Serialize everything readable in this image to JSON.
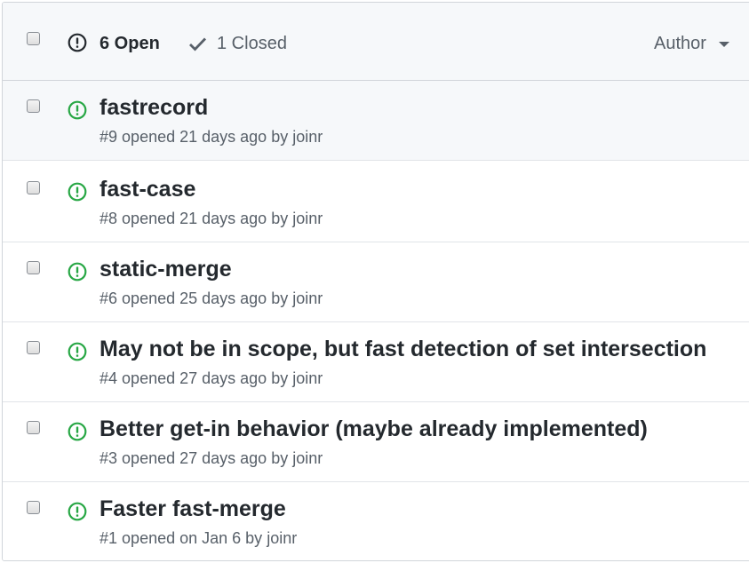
{
  "header": {
    "open_label": "6 Open",
    "closed_label": "1 Closed",
    "author_filter_label": "Author"
  },
  "colors": {
    "open_icon_green": "#28a745",
    "header_open_icon": "#24292e",
    "muted_text": "#586069"
  },
  "icons": {
    "open_issue": "issue-opened-icon",
    "closed": "check-icon",
    "dropdown": "caret-down-icon"
  },
  "issues": [
    {
      "title": "fastrecord",
      "number": "#9",
      "opened": "opened 21 days ago by",
      "author": "joinr"
    },
    {
      "title": "fast-case",
      "number": "#8",
      "opened": "opened 21 days ago by",
      "author": "joinr"
    },
    {
      "title": "static-merge",
      "number": "#6",
      "opened": "opened 25 days ago by",
      "author": "joinr"
    },
    {
      "title": "May not be in scope, but fast detection of set intersection",
      "number": "#4",
      "opened": "opened 27 days ago by",
      "author": "joinr"
    },
    {
      "title": "Better get-in behavior (maybe already implemented)",
      "number": "#3",
      "opened": "opened 27 days ago by",
      "author": "joinr"
    },
    {
      "title": "Faster fast-merge",
      "number": "#1",
      "opened": "opened on Jan 6 by",
      "author": "joinr"
    }
  ]
}
